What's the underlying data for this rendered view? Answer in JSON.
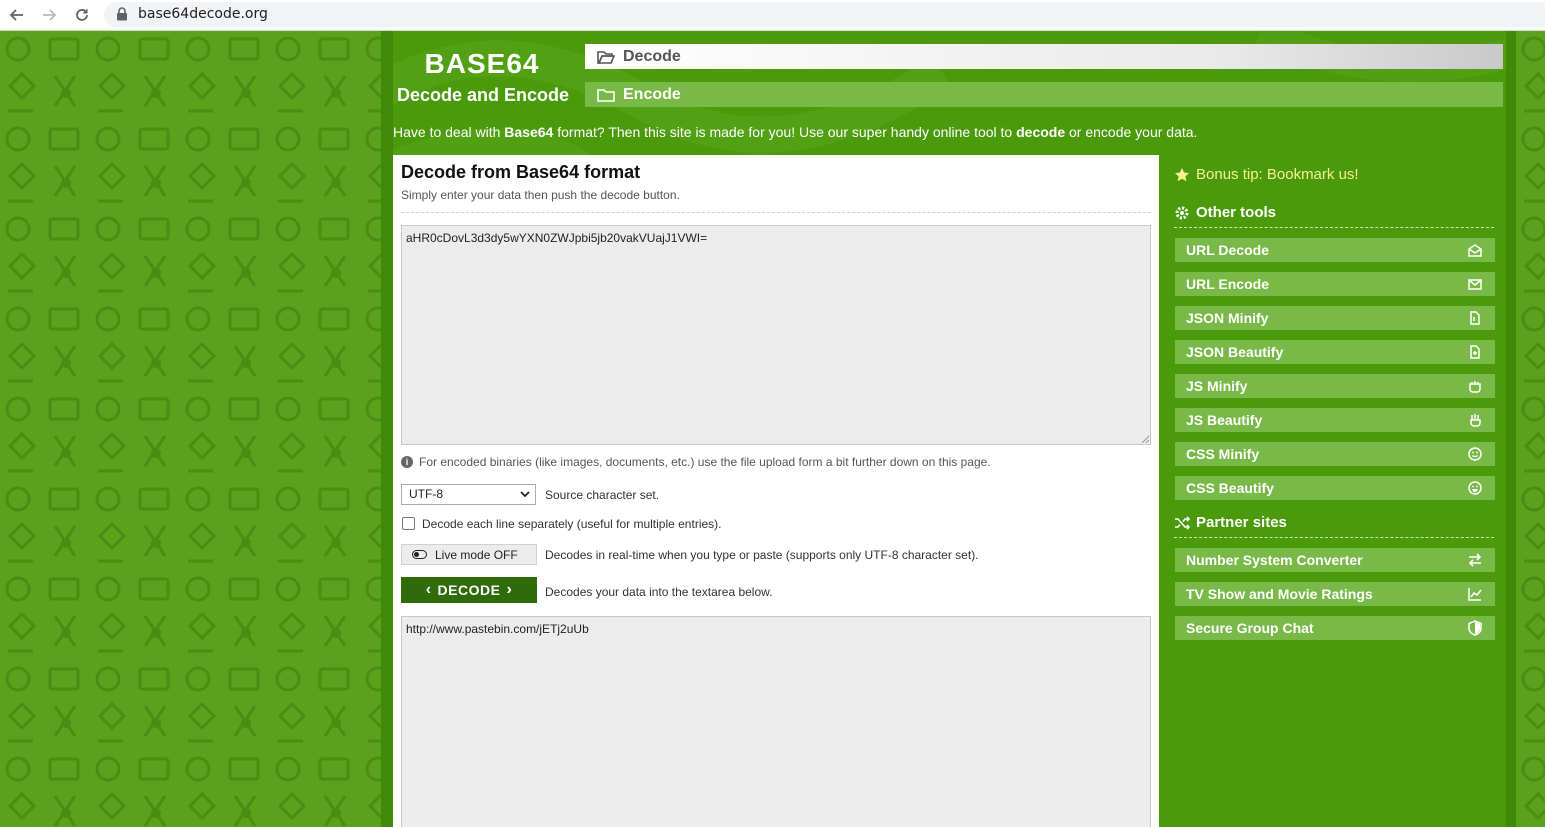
{
  "browser": {
    "url": "base64decode.org"
  },
  "header": {
    "logo_title": "BASE64",
    "logo_subtitle": "Decode and Encode",
    "tabs": [
      {
        "label": "Decode",
        "icon": "folder-open-icon",
        "active": true
      },
      {
        "label": "Encode",
        "icon": "folder-icon",
        "active": false
      }
    ],
    "tagline_parts": [
      "Have to deal with ",
      "Base64",
      " format? Then this site is made for you! Use our super handy online tool to ",
      "decode",
      " or encode your data."
    ]
  },
  "panel": {
    "title": "Decode from Base64 format",
    "subtitle": "Simply enter your data then push the decode button.",
    "input_value": "aHR0cDovL3d3dy5wYXN0ZWJpbi5jb20vakVUajJ1VWI=",
    "info_text": "For encoded binaries (like images, documents, etc.) use the file upload form a bit further down on this page.",
    "charset_value": "UTF-8",
    "charset_label": "Source character set.",
    "line_label": "Decode each line separately (useful for multiple entries).",
    "live_mode_label": "Live mode OFF",
    "live_mode_desc": "Decodes in real-time when you type or paste (supports only UTF-8 character set).",
    "decode_label": "DECODE",
    "decode_desc": "Decodes your data into the textarea below.",
    "output_value": "http://www.pastebin.com/jETj2uUb"
  },
  "sidebar": {
    "tip": "Bonus tip: Bookmark us!",
    "other_tools_heading": "Other tools",
    "other_tools": [
      {
        "label": "URL Decode",
        "icon": "envelope-open-icon"
      },
      {
        "label": "URL Encode",
        "icon": "envelope-icon"
      },
      {
        "label": "JSON Minify",
        "icon": "file-icon"
      },
      {
        "label": "JSON Beautify",
        "icon": "file-plus-icon"
      },
      {
        "label": "JS Minify",
        "icon": "hand-fist-icon"
      },
      {
        "label": "JS Beautify",
        "icon": "hand-icon"
      },
      {
        "label": "CSS Minify",
        "icon": "smile-icon"
      },
      {
        "label": "CSS Beautify",
        "icon": "grin-icon"
      }
    ],
    "partner_heading": "Partner sites",
    "partners": [
      {
        "label": "Number System Converter",
        "icon": "exchange-icon"
      },
      {
        "label": "TV Show and Movie Ratings",
        "icon": "chart-line-icon"
      },
      {
        "label": "Secure Group Chat",
        "icon": "shield-icon"
      }
    ]
  },
  "colors": {
    "page_green": "#4b9a0c",
    "tab_green": "#79b948",
    "button_dark_green": "#2f6b0a",
    "tip_yellow": "#f4f28e"
  }
}
